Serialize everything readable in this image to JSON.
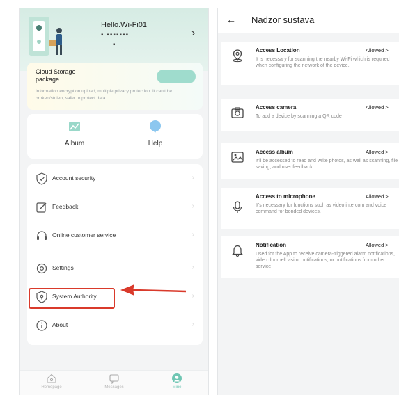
{
  "profile": {
    "greeting": "Hello.Wi-Fi01",
    "account_masked": "▪ ▪▪▪▪▪▪▪",
    "account_masked_2": "▪"
  },
  "cloud": {
    "title": "Cloud Storage package",
    "button": "",
    "description": "Information encryption upload, multiple privacy protection. It can't be broken/stolen, safer to protect data"
  },
  "quick": [
    {
      "label": "Album",
      "icon": "album-icon"
    },
    {
      "label": "Help",
      "icon": "help-icon"
    }
  ],
  "menu": [
    {
      "label": "Account security",
      "icon": "shield-check-icon"
    },
    {
      "label": "Feedback",
      "icon": "edit-icon"
    },
    {
      "label": "Online customer service",
      "icon": "headset-icon"
    },
    {
      "label": "Settings",
      "icon": "settings-icon"
    },
    {
      "label": "System Authority",
      "icon": "shield-lock-icon"
    },
    {
      "label": "About",
      "icon": "info-icon"
    }
  ],
  "tabs": [
    {
      "label": "Homepage",
      "icon": "home-icon"
    },
    {
      "label": "Messages",
      "icon": "message-icon"
    },
    {
      "label": "Mine",
      "icon": "user-icon",
      "active": true
    }
  ],
  "right": {
    "back": "←",
    "title": "Nadzor sustava",
    "permissions": [
      {
        "name": "Access Location",
        "status": "Allowed >",
        "icon": "location-icon",
        "desc": "It is necessary for scanning the nearby Wi-Fi which is required when configuring the network of the device."
      },
      {
        "name": "Access camera",
        "status": "Allowed >",
        "icon": "camera-icon",
        "desc": "To add a device by scanning a QR code"
      },
      {
        "name": "Access album",
        "status": "Allowed >",
        "icon": "image-icon",
        "desc": "It'll be accessed to read and write photos, as well as scanning, file saving, and user feedback."
      },
      {
        "name": "Access to microphone",
        "status": "Allowed >",
        "icon": "microphone-icon",
        "desc": "It's necessary for functions such as video intercom and voice command for bonded devices."
      },
      {
        "name": "Notification",
        "status": "Allowed >",
        "icon": "bell-icon",
        "desc": "Used for the App to receive camera-triggered alarm notifications, video doorbell visitor notifications, or notifications from other service"
      }
    ]
  },
  "colors": {
    "accent": "#6fc6b3",
    "highlight": "#d93a2b"
  }
}
